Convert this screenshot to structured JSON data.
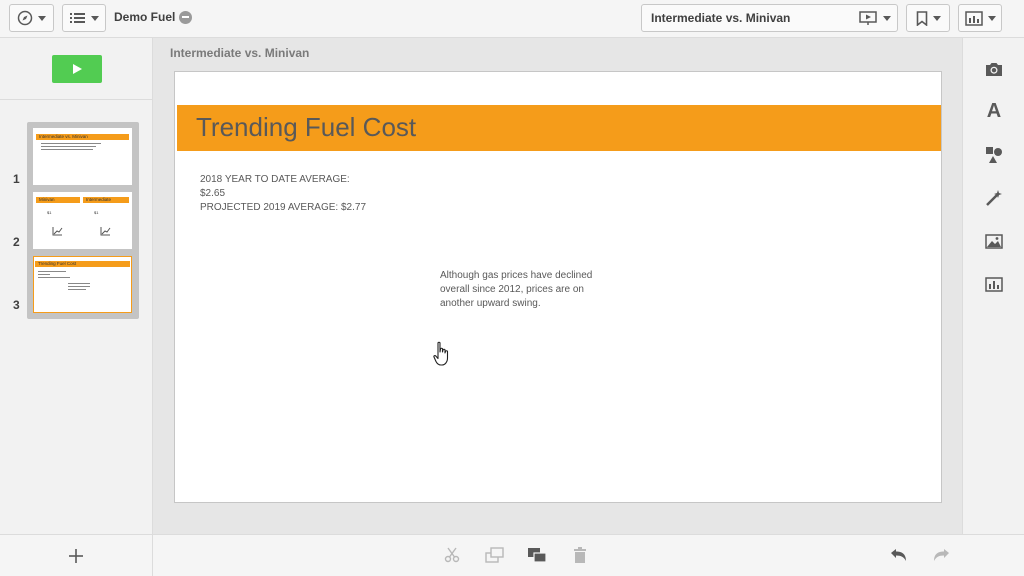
{
  "app": {
    "title": "Demo Fuel"
  },
  "toolbar": {
    "nav_icon": "compass-icon",
    "menu_icon": "list-icon",
    "sheet_selector": "Intermediate vs. Minivan",
    "present_icon": "presentation-icon",
    "bookmark_icon": "bookmark-icon",
    "sheets_icon": "sheet-chart-icon"
  },
  "leftpanel": {
    "play_icon": "play-icon",
    "slides": [
      {
        "number": "1",
        "title": "Intermediate vs. Minivan"
      },
      {
        "number": "2",
        "title_left": "Minivan",
        "title_right": "Intermediate",
        "value": "$1"
      },
      {
        "number": "3",
        "title": "Trending Fuel Cost"
      }
    ],
    "add_icon": "plus-icon"
  },
  "sheet": {
    "label": "Intermediate vs. Minivan"
  },
  "slide": {
    "title": "Trending Fuel Cost",
    "avg_line1": "2018 YEAR TO DATE AVERAGE:",
    "avg_line2": "$2.65",
    "avg_line3": "PROJECTED 2019 AVERAGE: $2.77",
    "note": "Although gas prices have declined overall since 2012, prices are on another upward swing."
  },
  "rightpanel": {
    "items": [
      "camera-icon",
      "text-icon",
      "shapes-icon",
      "effects-icon",
      "image-icon",
      "chart-icon"
    ],
    "text_glyph": "A"
  },
  "bottombar": {
    "tools": [
      "cut-icon",
      "copy-icon",
      "paste-icon",
      "delete-icon",
      "undo-icon",
      "redo-icon"
    ]
  },
  "colors": {
    "accent": "#f59c1a",
    "play": "#52cc52"
  }
}
